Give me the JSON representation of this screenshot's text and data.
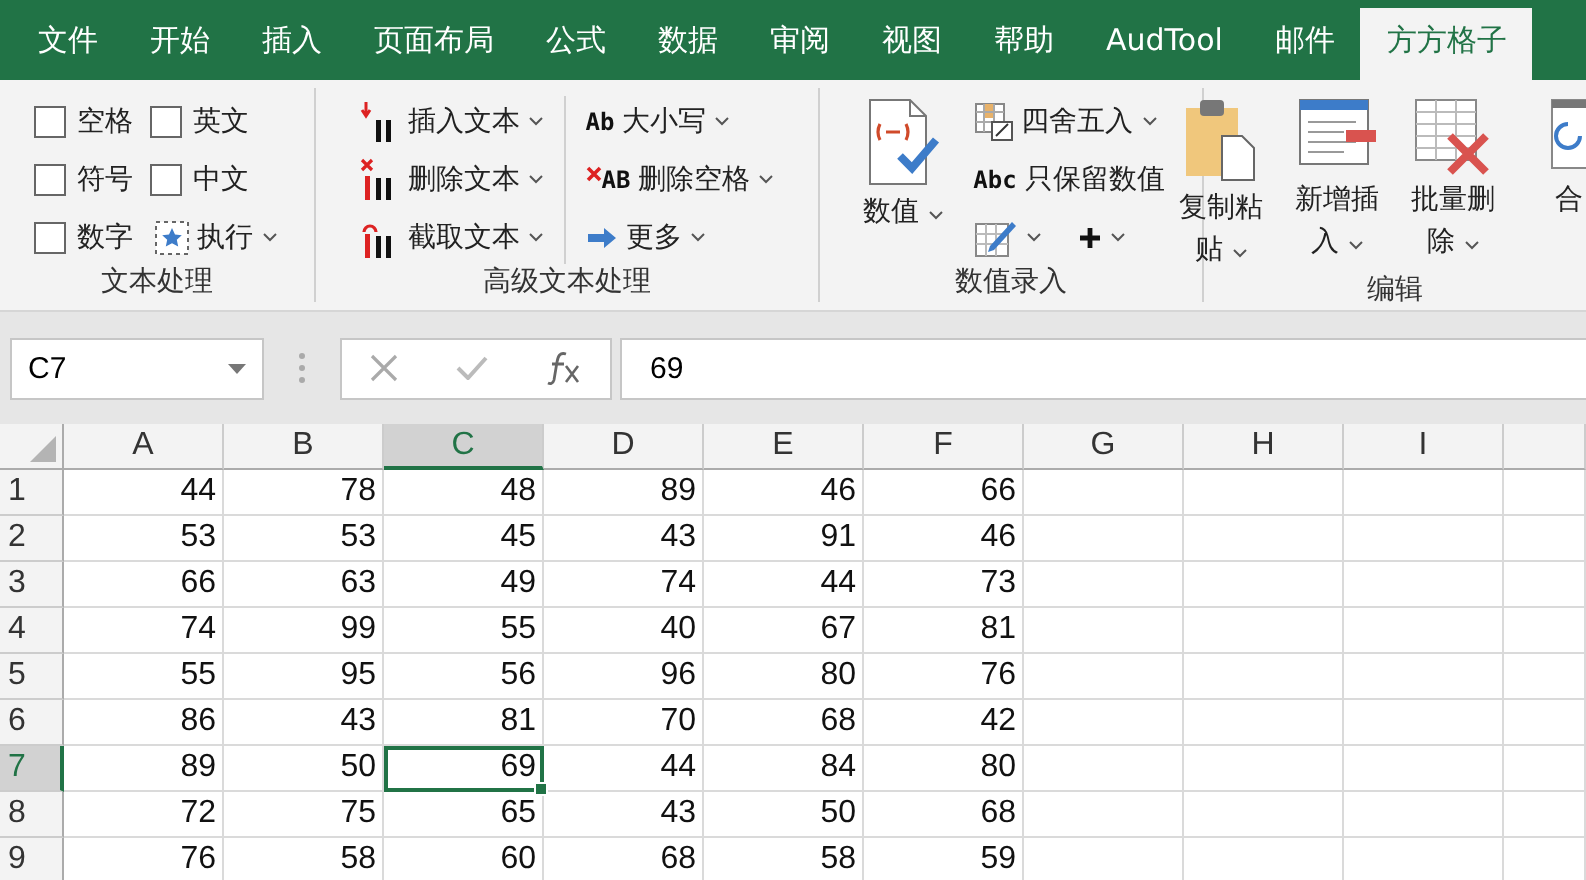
{
  "tabs": [
    {
      "label": "文件",
      "selected": false
    },
    {
      "label": "开始",
      "selected": false
    },
    {
      "label": "插入",
      "selected": false
    },
    {
      "label": "页面布局",
      "selected": false
    },
    {
      "label": "公式",
      "selected": false
    },
    {
      "label": "数据",
      "selected": false
    },
    {
      "label": "审阅",
      "selected": false
    },
    {
      "label": "视图",
      "selected": false
    },
    {
      "label": "帮助",
      "selected": false
    },
    {
      "label": "AudTool",
      "selected": false
    },
    {
      "label": "邮件",
      "selected": false
    },
    {
      "label": "方方格子",
      "selected": true
    }
  ],
  "ribbon": {
    "groups": [
      {
        "label": "文本处理",
        "columns": [
          [
            {
              "kind": "checkbox",
              "label": "空格",
              "checked": false
            },
            {
              "kind": "checkbox",
              "label": "符号",
              "checked": false
            },
            {
              "kind": "checkbox",
              "label": "数字",
              "checked": false
            }
          ],
          [
            {
              "kind": "checkbox",
              "label": "英文",
              "checked": false
            },
            {
              "kind": "checkbox",
              "label": "中文",
              "checked": false
            },
            {
              "kind": "small",
              "label": "执行",
              "dropdown": true
            }
          ]
        ]
      },
      {
        "label": "高级文本处理",
        "columns": [
          [
            {
              "kind": "small",
              "label": "插入文本",
              "dropdown": true
            },
            {
              "kind": "small",
              "label": "删除文本",
              "dropdown": true
            },
            {
              "kind": "small",
              "label": "截取文本",
              "dropdown": true
            }
          ],
          [
            {
              "kind": "small",
              "label": "大小写",
              "icon_text": "Ab",
              "dropdown": true
            },
            {
              "kind": "small",
              "label": "删除空格",
              "icon_text": "AB",
              "dropdown": true
            },
            {
              "kind": "small",
              "label": "更多",
              "dropdown": true
            }
          ]
        ]
      },
      {
        "label": "数值录入",
        "columns": [
          [
            {
              "kind": "large",
              "label": "数值",
              "dropdown": true
            }
          ],
          [
            {
              "kind": "small",
              "label": "四舍五入",
              "dropdown": true
            },
            {
              "kind": "small",
              "label": "只保留数值",
              "icon_text": "Abc",
              "dropdown": false
            },
            {
              "kind": "pair"
            }
          ]
        ]
      },
      {
        "label": "编辑",
        "columns": [
          [
            {
              "kind": "large",
              "label": "复制粘贴",
              "dropdown": true
            }
          ],
          [
            {
              "kind": "large",
              "label": "新增插入",
              "dropdown": true
            }
          ],
          [
            {
              "kind": "large",
              "label": "批量删除",
              "dropdown": true
            }
          ],
          [
            {
              "kind": "large",
              "label": "合",
              "dropdown": false
            }
          ]
        ]
      }
    ]
  },
  "formula_bar": {
    "name_box": "C7",
    "formula": "69"
  },
  "sheet": {
    "columns": [
      {
        "label": "A",
        "selected": false
      },
      {
        "label": "B",
        "selected": false
      },
      {
        "label": "C",
        "selected": true
      },
      {
        "label": "D",
        "selected": false
      },
      {
        "label": "E",
        "selected": false
      },
      {
        "label": "F",
        "selected": false
      },
      {
        "label": "G",
        "selected": false
      },
      {
        "label": "H",
        "selected": false
      },
      {
        "label": "I",
        "selected": false
      }
    ],
    "rows": [
      {
        "label": "1",
        "selected": false,
        "cells": [
          {
            "value": "44",
            "selected": false
          },
          {
            "value": "78",
            "selected": false
          },
          {
            "value": "48",
            "selected": false
          },
          {
            "value": "89",
            "selected": false
          },
          {
            "value": "46",
            "selected": false
          },
          {
            "value": "66",
            "selected": false
          }
        ]
      },
      {
        "label": "2",
        "selected": false,
        "cells": [
          {
            "value": "53",
            "selected": false
          },
          {
            "value": "53",
            "selected": false
          },
          {
            "value": "45",
            "selected": false
          },
          {
            "value": "43",
            "selected": false
          },
          {
            "value": "91",
            "selected": false
          },
          {
            "value": "46",
            "selected": false
          }
        ]
      },
      {
        "label": "3",
        "selected": false,
        "cells": [
          {
            "value": "66",
            "selected": false
          },
          {
            "value": "63",
            "selected": false
          },
          {
            "value": "49",
            "selected": false
          },
          {
            "value": "74",
            "selected": false
          },
          {
            "value": "44",
            "selected": false
          },
          {
            "value": "73",
            "selected": false
          }
        ]
      },
      {
        "label": "4",
        "selected": false,
        "cells": [
          {
            "value": "74",
            "selected": false
          },
          {
            "value": "99",
            "selected": false
          },
          {
            "value": "55",
            "selected": false
          },
          {
            "value": "40",
            "selected": false
          },
          {
            "value": "67",
            "selected": false
          },
          {
            "value": "81",
            "selected": false
          }
        ]
      },
      {
        "label": "5",
        "selected": false,
        "cells": [
          {
            "value": "55",
            "selected": false
          },
          {
            "value": "95",
            "selected": false
          },
          {
            "value": "56",
            "selected": false
          },
          {
            "value": "96",
            "selected": false
          },
          {
            "value": "80",
            "selected": false
          },
          {
            "value": "76",
            "selected": false
          }
        ]
      },
      {
        "label": "6",
        "selected": false,
        "cells": [
          {
            "value": "86",
            "selected": false
          },
          {
            "value": "43",
            "selected": false
          },
          {
            "value": "81",
            "selected": false
          },
          {
            "value": "70",
            "selected": false
          },
          {
            "value": "68",
            "selected": false
          },
          {
            "value": "42",
            "selected": false
          }
        ]
      },
      {
        "label": "7",
        "selected": true,
        "cells": [
          {
            "value": "89",
            "selected": false
          },
          {
            "value": "50",
            "selected": false
          },
          {
            "value": "69",
            "selected": true
          },
          {
            "value": "44",
            "selected": false
          },
          {
            "value": "84",
            "selected": false
          },
          {
            "value": "80",
            "selected": false
          }
        ]
      },
      {
        "label": "8",
        "selected": false,
        "cells": [
          {
            "value": "72",
            "selected": false
          },
          {
            "value": "75",
            "selected": false
          },
          {
            "value": "65",
            "selected": false
          },
          {
            "value": "43",
            "selected": false
          },
          {
            "value": "50",
            "selected": false
          },
          {
            "value": "68",
            "selected": false
          }
        ]
      },
      {
        "label": "9",
        "selected": false,
        "cells": [
          {
            "value": "76",
            "selected": false
          },
          {
            "value": "58",
            "selected": false
          },
          {
            "value": "60",
            "selected": false
          },
          {
            "value": "68",
            "selected": false
          },
          {
            "value": "58",
            "selected": false
          },
          {
            "value": "59",
            "selected": false
          }
        ]
      }
    ]
  }
}
